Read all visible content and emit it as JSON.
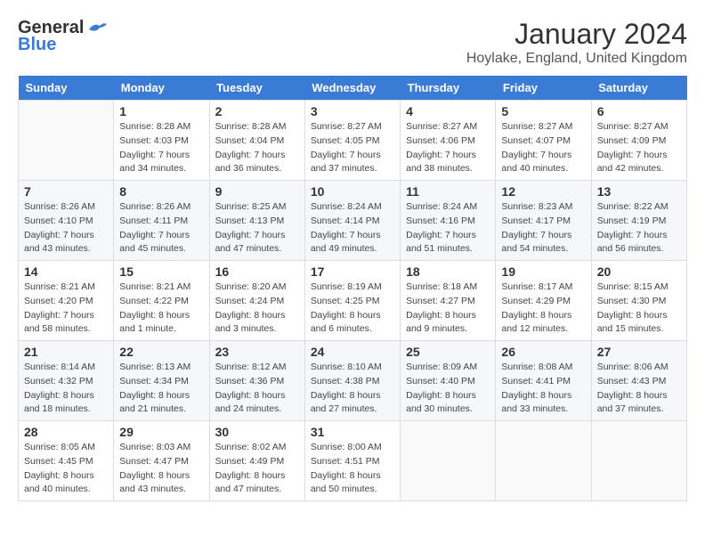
{
  "header": {
    "logo_general": "General",
    "logo_blue": "Blue",
    "month_title": "January 2024",
    "location": "Hoylake, England, United Kingdom"
  },
  "days_of_week": [
    "Sunday",
    "Monday",
    "Tuesday",
    "Wednesday",
    "Thursday",
    "Friday",
    "Saturday"
  ],
  "weeks": [
    [
      {
        "day": "",
        "info": ""
      },
      {
        "day": "1",
        "info": "Sunrise: 8:28 AM\nSunset: 4:03 PM\nDaylight: 7 hours\nand 34 minutes."
      },
      {
        "day": "2",
        "info": "Sunrise: 8:28 AM\nSunset: 4:04 PM\nDaylight: 7 hours\nand 36 minutes."
      },
      {
        "day": "3",
        "info": "Sunrise: 8:27 AM\nSunset: 4:05 PM\nDaylight: 7 hours\nand 37 minutes."
      },
      {
        "day": "4",
        "info": "Sunrise: 8:27 AM\nSunset: 4:06 PM\nDaylight: 7 hours\nand 38 minutes."
      },
      {
        "day": "5",
        "info": "Sunrise: 8:27 AM\nSunset: 4:07 PM\nDaylight: 7 hours\nand 40 minutes."
      },
      {
        "day": "6",
        "info": "Sunrise: 8:27 AM\nSunset: 4:09 PM\nDaylight: 7 hours\nand 42 minutes."
      }
    ],
    [
      {
        "day": "7",
        "info": "Sunrise: 8:26 AM\nSunset: 4:10 PM\nDaylight: 7 hours\nand 43 minutes."
      },
      {
        "day": "8",
        "info": "Sunrise: 8:26 AM\nSunset: 4:11 PM\nDaylight: 7 hours\nand 45 minutes."
      },
      {
        "day": "9",
        "info": "Sunrise: 8:25 AM\nSunset: 4:13 PM\nDaylight: 7 hours\nand 47 minutes."
      },
      {
        "day": "10",
        "info": "Sunrise: 8:24 AM\nSunset: 4:14 PM\nDaylight: 7 hours\nand 49 minutes."
      },
      {
        "day": "11",
        "info": "Sunrise: 8:24 AM\nSunset: 4:16 PM\nDaylight: 7 hours\nand 51 minutes."
      },
      {
        "day": "12",
        "info": "Sunrise: 8:23 AM\nSunset: 4:17 PM\nDaylight: 7 hours\nand 54 minutes."
      },
      {
        "day": "13",
        "info": "Sunrise: 8:22 AM\nSunset: 4:19 PM\nDaylight: 7 hours\nand 56 minutes."
      }
    ],
    [
      {
        "day": "14",
        "info": "Sunrise: 8:21 AM\nSunset: 4:20 PM\nDaylight: 7 hours\nand 58 minutes."
      },
      {
        "day": "15",
        "info": "Sunrise: 8:21 AM\nSunset: 4:22 PM\nDaylight: 8 hours\nand 1 minute."
      },
      {
        "day": "16",
        "info": "Sunrise: 8:20 AM\nSunset: 4:24 PM\nDaylight: 8 hours\nand 3 minutes."
      },
      {
        "day": "17",
        "info": "Sunrise: 8:19 AM\nSunset: 4:25 PM\nDaylight: 8 hours\nand 6 minutes."
      },
      {
        "day": "18",
        "info": "Sunrise: 8:18 AM\nSunset: 4:27 PM\nDaylight: 8 hours\nand 9 minutes."
      },
      {
        "day": "19",
        "info": "Sunrise: 8:17 AM\nSunset: 4:29 PM\nDaylight: 8 hours\nand 12 minutes."
      },
      {
        "day": "20",
        "info": "Sunrise: 8:15 AM\nSunset: 4:30 PM\nDaylight: 8 hours\nand 15 minutes."
      }
    ],
    [
      {
        "day": "21",
        "info": "Sunrise: 8:14 AM\nSunset: 4:32 PM\nDaylight: 8 hours\nand 18 minutes."
      },
      {
        "day": "22",
        "info": "Sunrise: 8:13 AM\nSunset: 4:34 PM\nDaylight: 8 hours\nand 21 minutes."
      },
      {
        "day": "23",
        "info": "Sunrise: 8:12 AM\nSunset: 4:36 PM\nDaylight: 8 hours\nand 24 minutes."
      },
      {
        "day": "24",
        "info": "Sunrise: 8:10 AM\nSunset: 4:38 PM\nDaylight: 8 hours\nand 27 minutes."
      },
      {
        "day": "25",
        "info": "Sunrise: 8:09 AM\nSunset: 4:40 PM\nDaylight: 8 hours\nand 30 minutes."
      },
      {
        "day": "26",
        "info": "Sunrise: 8:08 AM\nSunset: 4:41 PM\nDaylight: 8 hours\nand 33 minutes."
      },
      {
        "day": "27",
        "info": "Sunrise: 8:06 AM\nSunset: 4:43 PM\nDaylight: 8 hours\nand 37 minutes."
      }
    ],
    [
      {
        "day": "28",
        "info": "Sunrise: 8:05 AM\nSunset: 4:45 PM\nDaylight: 8 hours\nand 40 minutes."
      },
      {
        "day": "29",
        "info": "Sunrise: 8:03 AM\nSunset: 4:47 PM\nDaylight: 8 hours\nand 43 minutes."
      },
      {
        "day": "30",
        "info": "Sunrise: 8:02 AM\nSunset: 4:49 PM\nDaylight: 8 hours\nand 47 minutes."
      },
      {
        "day": "31",
        "info": "Sunrise: 8:00 AM\nSunset: 4:51 PM\nDaylight: 8 hours\nand 50 minutes."
      },
      {
        "day": "",
        "info": ""
      },
      {
        "day": "",
        "info": ""
      },
      {
        "day": "",
        "info": ""
      }
    ]
  ]
}
